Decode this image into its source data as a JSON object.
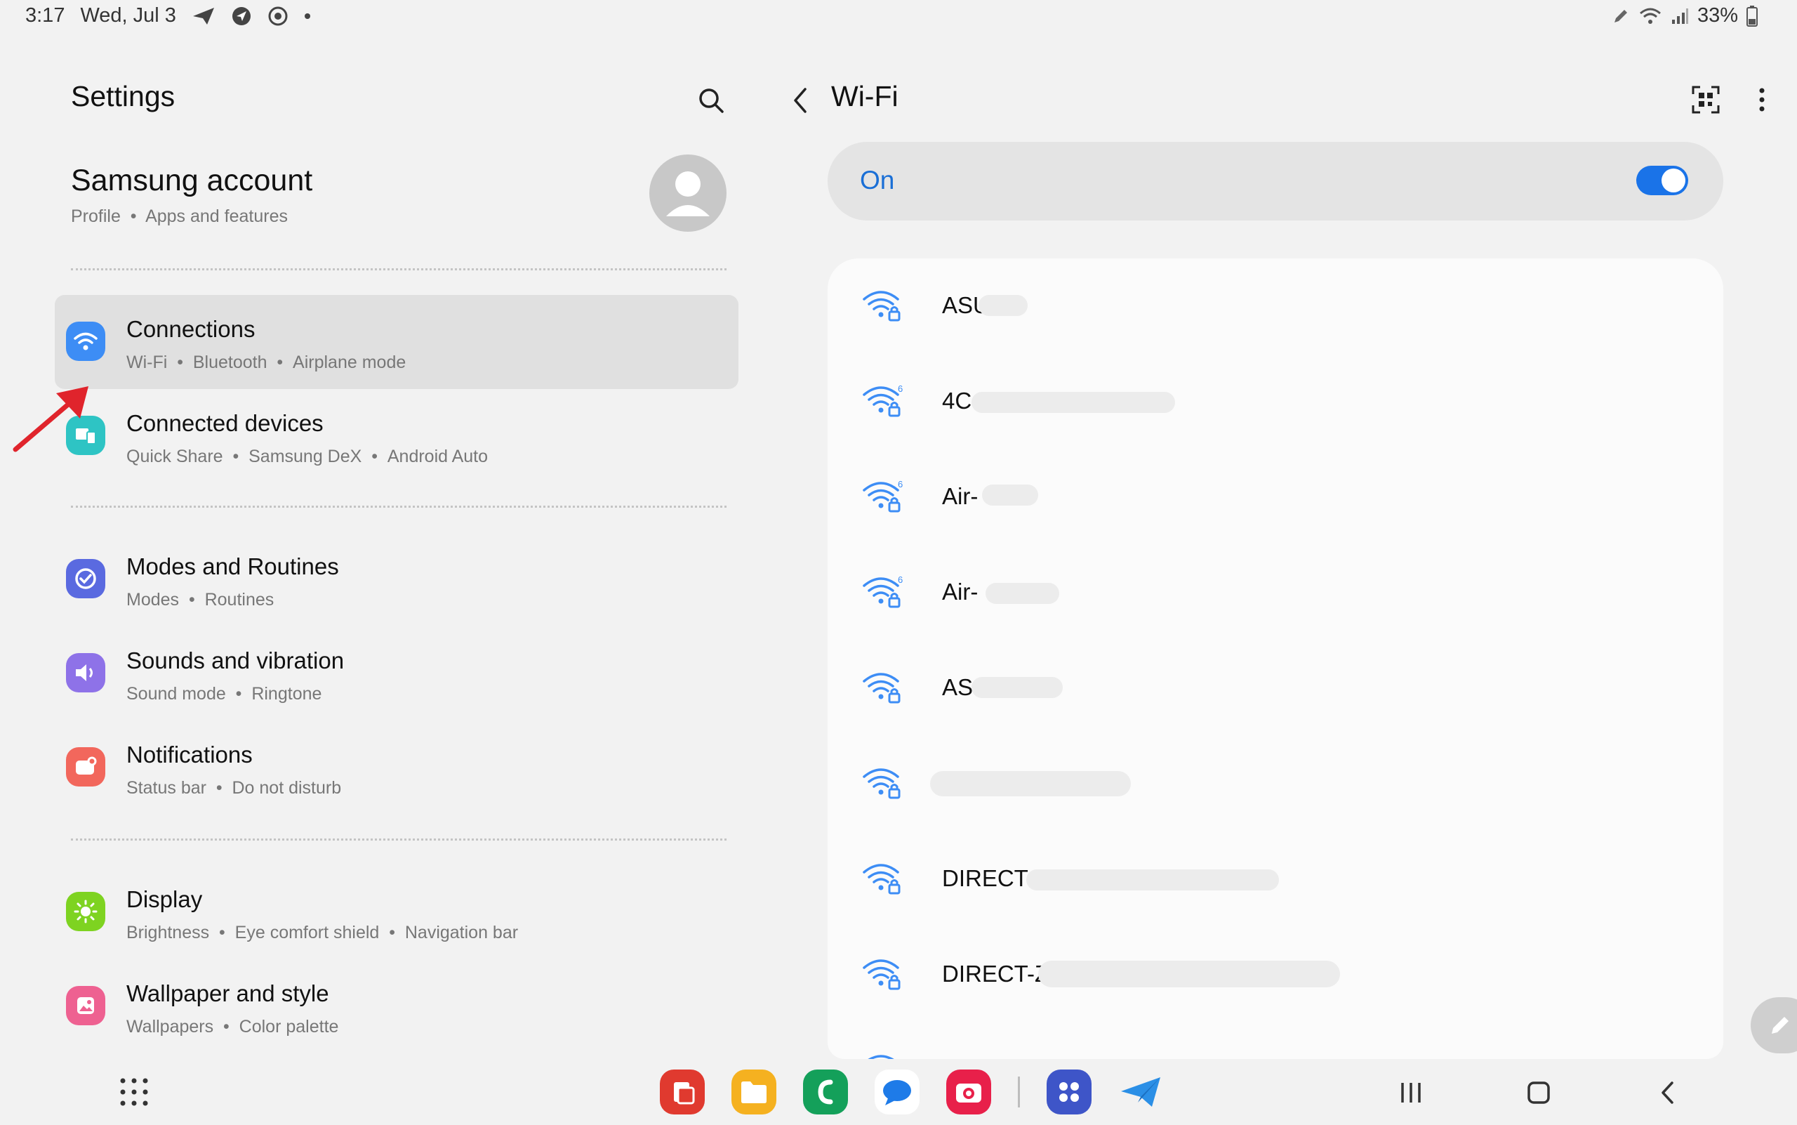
{
  "status_bar": {
    "time": "3:17",
    "date": "Wed, Jul 3",
    "battery": "33%"
  },
  "settings": {
    "title": "Settings",
    "account": {
      "name": "Samsung account",
      "sub_1": "Profile",
      "sub_2": "Apps and features"
    },
    "items": [
      {
        "title": "Connections",
        "subs": [
          "Wi-Fi",
          "Bluetooth",
          "Airplane mode"
        ],
        "icon": "wifi-icon",
        "color": "#3d8df5"
      },
      {
        "title": "Connected devices",
        "subs": [
          "Quick Share",
          "Samsung DeX",
          "Android Auto"
        ],
        "icon": "devices-icon",
        "color": "#2ec4c4"
      },
      {
        "title": "Modes and Routines",
        "subs": [
          "Modes",
          "Routines"
        ],
        "icon": "check-circle-icon",
        "color": "#5a6ae0"
      },
      {
        "title": "Sounds and vibration",
        "subs": [
          "Sound mode",
          "Ringtone"
        ],
        "icon": "speaker-icon",
        "color": "#8e72e8"
      },
      {
        "title": "Notifications",
        "subs": [
          "Status bar",
          "Do not disturb"
        ],
        "icon": "notification-icon",
        "color": "#f2675c"
      },
      {
        "title": "Display",
        "subs": [
          "Brightness",
          "Eye comfort shield",
          "Navigation bar"
        ],
        "icon": "sun-icon",
        "color": "#7ed321"
      },
      {
        "title": "Wallpaper and style",
        "subs": [
          "Wallpapers",
          "Color palette"
        ],
        "icon": "wallpaper-icon",
        "color": "#ee6191"
      }
    ]
  },
  "wifi": {
    "title": "Wi-Fi",
    "toggle_label": "On",
    "toggle_on": true,
    "networks": [
      {
        "ssid": "ASU",
        "wifi6": false
      },
      {
        "ssid": "4C",
        "wifi6": true
      },
      {
        "ssid": "Air-",
        "wifi6": true
      },
      {
        "ssid": "Air-",
        "wifi6": true
      },
      {
        "ssid": "AS",
        "wifi6": false
      },
      {
        "ssid": "",
        "wifi6": false
      },
      {
        "ssid": "DIRECT-",
        "wifi6": false
      },
      {
        "ssid": "DIRECT-Z",
        "wifi6": false
      }
    ]
  },
  "colors": {
    "accent": "#1a73e8",
    "selected_bg": "#e0e0e0",
    "annotation_arrow": "#e0242c"
  }
}
